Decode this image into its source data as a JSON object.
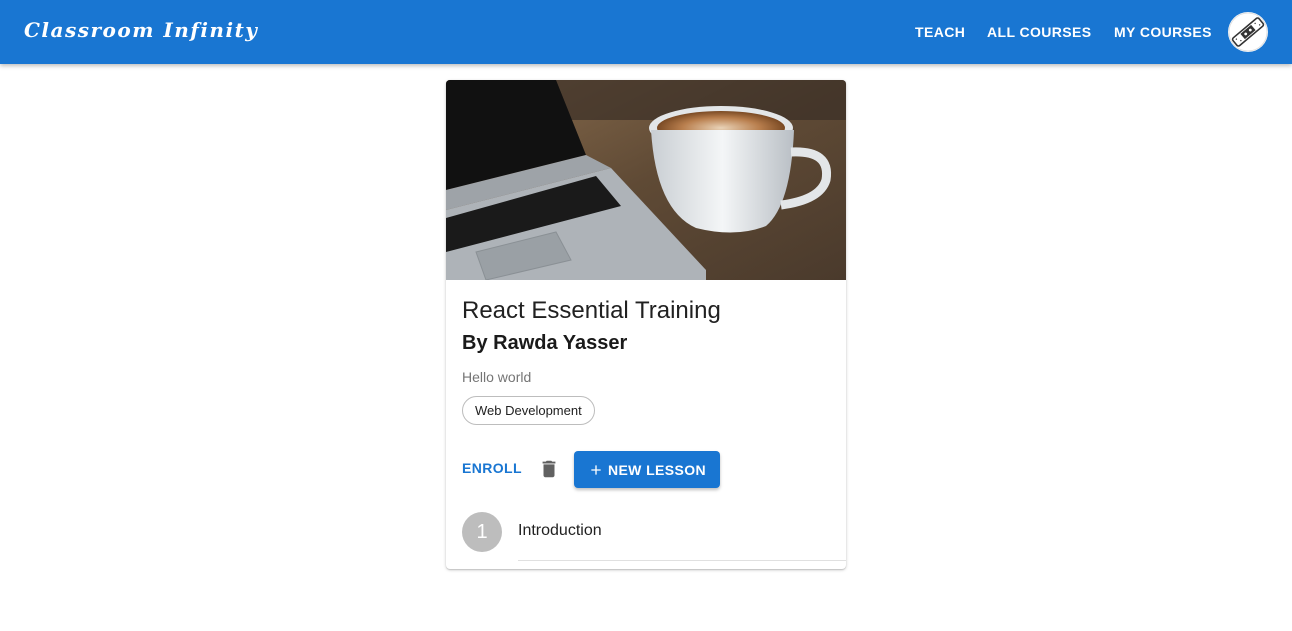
{
  "app": {
    "brand": "Classroom Infinity"
  },
  "nav": {
    "teach": "TEACH",
    "all_courses": "ALL COURSES",
    "my_courses": "MY COURSES"
  },
  "course": {
    "title": "React Essential Training",
    "author": "By Rawda Yasser",
    "description": "Hello world",
    "category": "Web Development",
    "actions": {
      "enroll": "ENROLL",
      "new_lesson": "NEW LESSON"
    },
    "lessons": [
      {
        "number": "1",
        "title": "Introduction"
      }
    ]
  },
  "colors": {
    "primary": "#1976d2",
    "chip_border": "#bdbdbd",
    "avatar_bg": "#bdbdbd"
  },
  "icons": {
    "delete": "trash-icon",
    "add": "plus-icon",
    "avatar": "user-avatar-icon"
  }
}
